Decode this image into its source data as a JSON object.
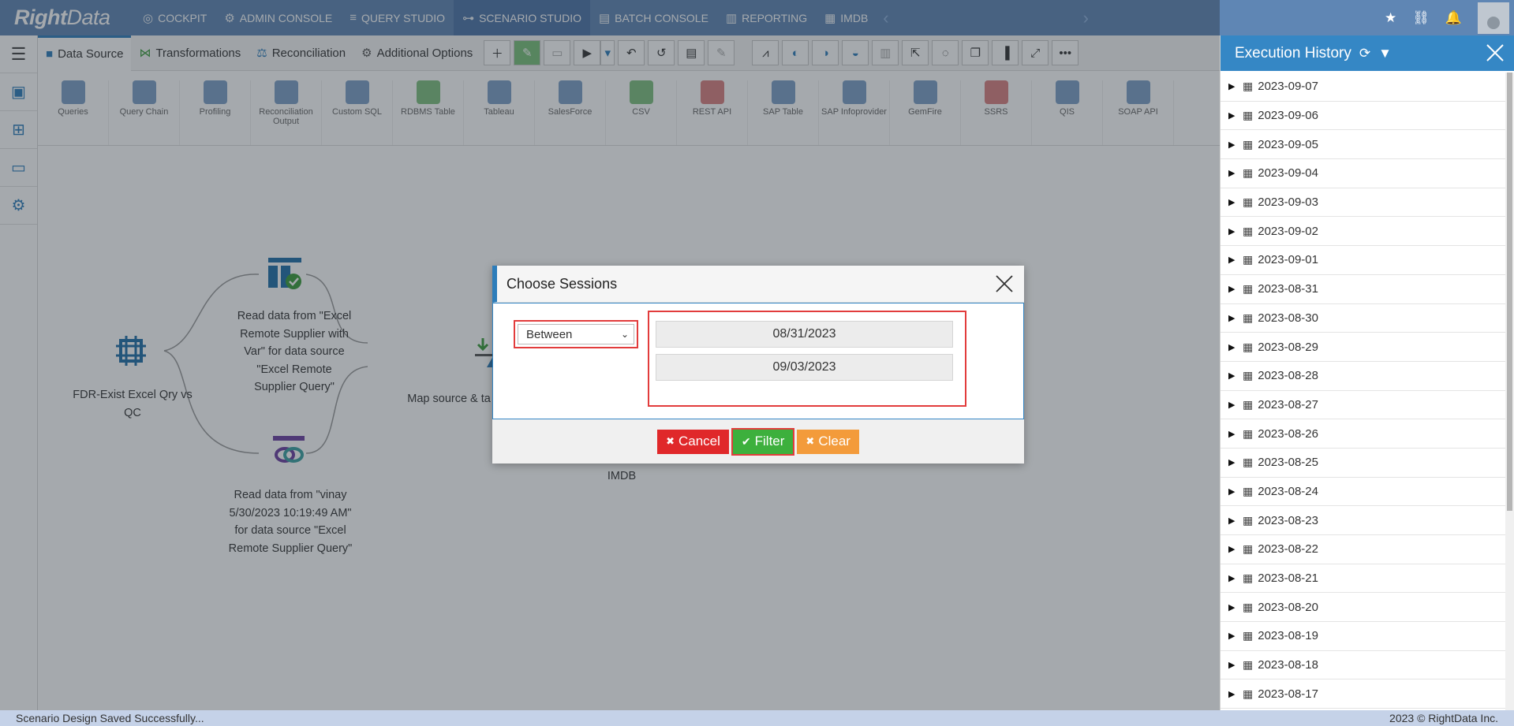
{
  "brand": {
    "logo_bold": "Right",
    "logo_light": "Data"
  },
  "nav": [
    {
      "label": "COCKPIT",
      "icon": "gauge-icon",
      "glyph": "◎"
    },
    {
      "label": "ADMIN CONSOLE",
      "icon": "gear-icon",
      "glyph": "⚙"
    },
    {
      "label": "QUERY STUDIO",
      "icon": "database-icon",
      "glyph": "≡"
    },
    {
      "label": "SCENARIO STUDIO",
      "icon": "flow-icon",
      "glyph": "⊶",
      "active": true
    },
    {
      "label": "BATCH CONSOLE",
      "icon": "folder-icon",
      "glyph": "▤"
    },
    {
      "label": "REPORTING",
      "icon": "report-icon",
      "glyph": "▥"
    },
    {
      "label": "IMDB",
      "icon": "table-icon",
      "glyph": "▦"
    }
  ],
  "top_icons": {
    "star": "★",
    "link": "⛓",
    "bell": "🔔"
  },
  "tabs": {
    "data_source": "Data Source",
    "transformations": "Transformations",
    "reconciliation": "Reconciliation",
    "additional_options": "Additional Options"
  },
  "components": [
    "Queries",
    "Query Chain",
    "Profiling",
    "Reconciliation Output",
    "Custom SQL",
    "RDBMS Table",
    "Tableau",
    "SalesForce",
    "CSV",
    "REST API",
    "SAP Table",
    "SAP Infoprovider",
    "GemFire",
    "SSRS",
    "QIS",
    "SOAP API"
  ],
  "canvas": {
    "node1": "FDR-Exist Excel Qry vs QC",
    "node2": "Read data from \"Excel Remote Supplier with Var\" for data source \"Excel Remote Supplier Query\"",
    "node3": "Read data from \"vinay 5/30/2023 10:19:49 AM\" for data source \"Excel Remote Supplier Query\"",
    "node4": "Map source & ta fields",
    "node5": "IMDB"
  },
  "history": {
    "title": "Execution History",
    "dates": [
      "2023-09-07",
      "2023-09-06",
      "2023-09-05",
      "2023-09-04",
      "2023-09-03",
      "2023-09-02",
      "2023-09-01",
      "2023-08-31",
      "2023-08-30",
      "2023-08-29",
      "2023-08-28",
      "2023-08-27",
      "2023-08-26",
      "2023-08-25",
      "2023-08-24",
      "2023-08-23",
      "2023-08-22",
      "2023-08-21",
      "2023-08-20",
      "2023-08-19",
      "2023-08-18",
      "2023-08-17"
    ]
  },
  "dialog": {
    "title": "Choose Sessions",
    "operator": "Between",
    "from_date": "08/31/2023",
    "to_date": "09/03/2023",
    "cancel": "Cancel",
    "filter": "Filter",
    "clear": "Clear"
  },
  "status": {
    "message": "Scenario Design Saved Successfully...",
    "copyright": "2023 © RightData Inc."
  },
  "colors": {
    "nav_bg": "#5f86b4",
    "accent": "#2d7dba",
    "cancel": "#e0282a",
    "filter": "#3db03d",
    "clear": "#f39b3b"
  }
}
